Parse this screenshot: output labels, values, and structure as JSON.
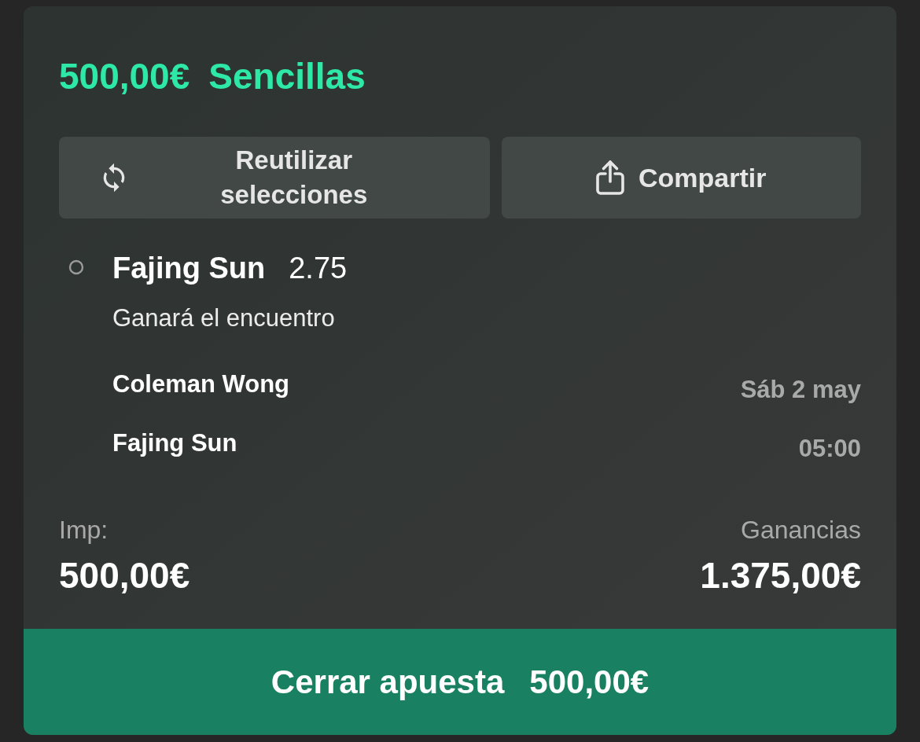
{
  "bet_summary": {
    "stake": "500,00€",
    "type": "Sencillas"
  },
  "actions": [
    {
      "kind": "reuse",
      "label": "Reutilizar selecciones"
    },
    {
      "kind": "share",
      "label": "Compartir"
    }
  ],
  "selection": {
    "pick": "Fajing Sun",
    "odds": "2.75",
    "market": "Ganará el encuentro",
    "participants": [
      "Coleman Wong",
      "Fajing Sun"
    ],
    "date": "Sáb 2 may",
    "time": "05:00"
  },
  "totals": {
    "stake_label": "Imp:",
    "stake": "500,00€",
    "winnings_label": "Ganancias",
    "winnings": "1.375,00€"
  },
  "place_bet": {
    "label": "Cerrar apuesta",
    "amount": "500,00€"
  }
}
